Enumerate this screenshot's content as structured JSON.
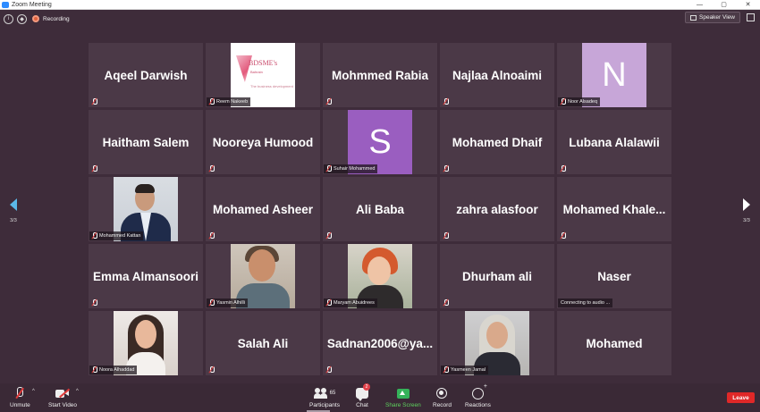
{
  "window": {
    "title": "Zoom Meeting",
    "controls": [
      "—",
      "▢",
      "✕"
    ]
  },
  "topbar": {
    "recording_label": "Recording",
    "speaker_view_label": "Speaker View"
  },
  "pager": {
    "left_page": "3/3",
    "right_page": "3/3"
  },
  "tiles": [
    {
      "name": "Aqeel Darwish",
      "label": "",
      "kind": "name"
    },
    {
      "name": "",
      "label": "Reem Nakeeb",
      "kind": "logo",
      "logo_text": "BDSME's",
      "logo_sub": "Bahrain",
      "logo_sub2": "The business development"
    },
    {
      "name": "Mohmmed Rabia",
      "label": "",
      "kind": "name"
    },
    {
      "name": "Najlaa Alnoaimi",
      "label": "",
      "kind": "name"
    },
    {
      "name": "",
      "label": "Noor Alsadeq",
      "kind": "avatar",
      "letter": "N",
      "color": "#c7a6d8"
    },
    {
      "name": "Haitham Salem",
      "label": "",
      "kind": "name"
    },
    {
      "name": "Nooreya Humood",
      "label": "",
      "kind": "name"
    },
    {
      "name": "",
      "label": "Suhair Mohammed",
      "kind": "avatar",
      "letter": "S",
      "color": "#9a5ec0"
    },
    {
      "name": "Mohamed Dhaif",
      "label": "",
      "kind": "name"
    },
    {
      "name": "Lubana Alalawii",
      "label": "",
      "kind": "name"
    },
    {
      "name": "",
      "label": "Mohammed Kattan",
      "kind": "photo-man"
    },
    {
      "name": "Mohamed Asheer",
      "label": "",
      "kind": "name"
    },
    {
      "name": "Ali Baba",
      "label": "",
      "kind": "name"
    },
    {
      "name": "zahra alasfoor",
      "label": "",
      "kind": "name"
    },
    {
      "name": "Mohamed  Khale...",
      "label": "",
      "kind": "name"
    },
    {
      "name": "Emma Almansoori",
      "label": "",
      "kind": "name"
    },
    {
      "name": "",
      "label": "Yasmin Alhilli",
      "kind": "photo-woman1"
    },
    {
      "name": "",
      "label": "Maryam Abuidrees",
      "kind": "photo-woman2"
    },
    {
      "name": "Dhurham ali",
      "label": "",
      "kind": "name"
    },
    {
      "name": "Naser",
      "label": "Connecting to audio ...",
      "kind": "name-connecting"
    },
    {
      "name": "",
      "label": "Noora Alhaddad",
      "kind": "photo-woman3"
    },
    {
      "name": "Salah Ali",
      "label": "",
      "kind": "name"
    },
    {
      "name": "Sadnan2006@ya...",
      "label": "",
      "kind": "name"
    },
    {
      "name": "",
      "label": "Yasmeen Jamal",
      "kind": "photo-woman4"
    },
    {
      "name": "Mohamed",
      "label": "",
      "kind": "name-nomute"
    }
  ],
  "toolbar": {
    "unmute": "Unmute",
    "start_video": "Start Video",
    "participants": "Participants",
    "participants_count": "65",
    "chat": "Chat",
    "chat_badge": "2",
    "share_screen": "Share Screen",
    "record": "Record",
    "reactions": "Reactions",
    "leave": "Leave"
  },
  "colors": {
    "background": "#3e2c3a",
    "tile": "#4b3947",
    "share": "#5ed35e",
    "leave": "#e02828"
  }
}
